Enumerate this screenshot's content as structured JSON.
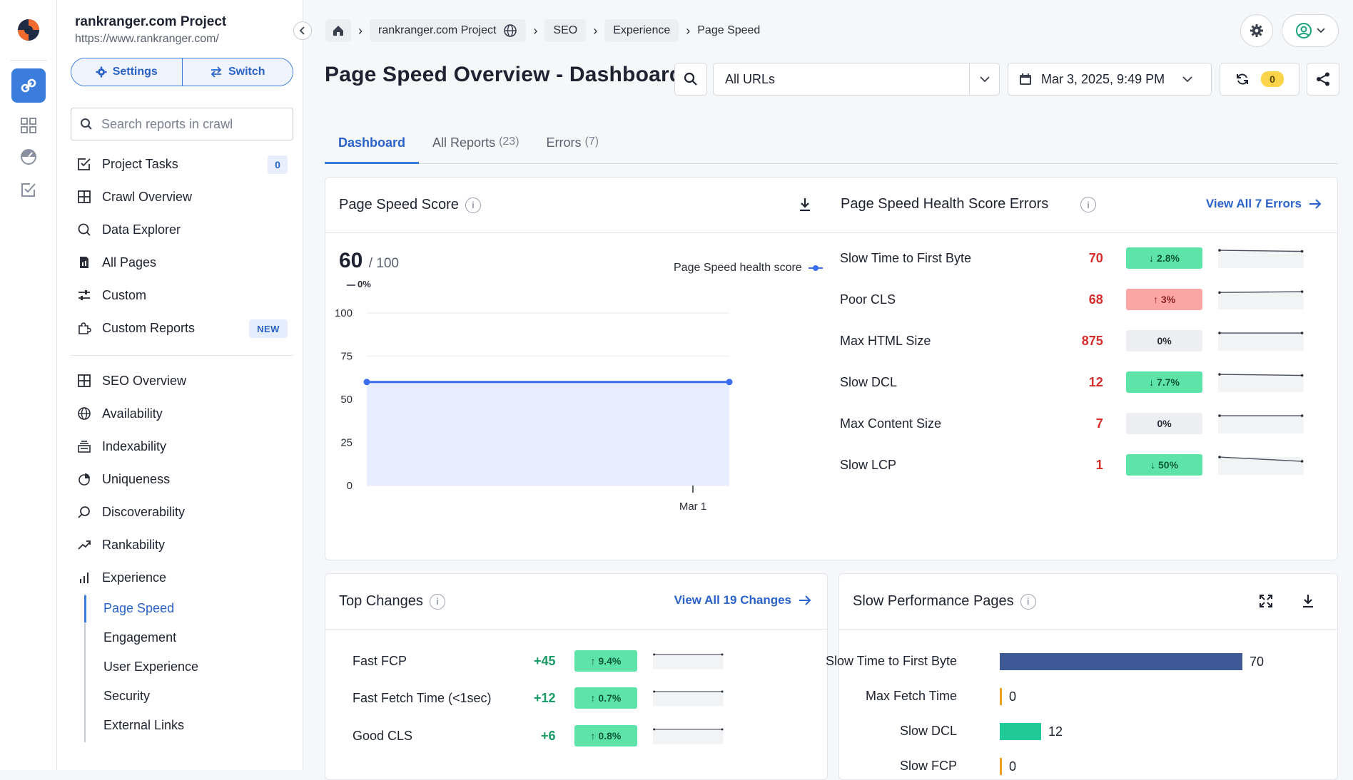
{
  "sidebar": {
    "project_title": "rankranger.com Project",
    "project_url": "https://www.rankranger.com/",
    "settings_label": "Settings",
    "switch_label": "Switch",
    "search_placeholder": "Search reports in crawl",
    "nav_top": [
      {
        "label": "Project Tasks",
        "icon": "tasks-icon",
        "badge": "0"
      },
      {
        "label": "Crawl Overview",
        "icon": "grid-icon"
      },
      {
        "label": "Data Explorer",
        "icon": "search-icon"
      },
      {
        "label": "All Pages",
        "icon": "pages-icon"
      },
      {
        "label": "Custom",
        "icon": "sliders-icon"
      },
      {
        "label": "Custom Reports",
        "icon": "puzzle-icon",
        "tag": "NEW"
      }
    ],
    "nav_bottom": [
      {
        "label": "SEO Overview",
        "icon": "grid-icon"
      },
      {
        "label": "Availability",
        "icon": "globe-icon"
      },
      {
        "label": "Indexability",
        "icon": "stack-icon"
      },
      {
        "label": "Uniqueness",
        "icon": "pie-icon"
      },
      {
        "label": "Discoverability",
        "icon": "magnifier-icon"
      },
      {
        "label": "Rankability",
        "icon": "trend-icon"
      },
      {
        "label": "Experience",
        "icon": "bars-icon"
      }
    ],
    "experience_sub": [
      "Page Speed",
      "Engagement",
      "User Experience",
      "Security",
      "External Links"
    ]
  },
  "breadcrumb": {
    "project": "rankranger.com Project",
    "seo": "SEO",
    "experience": "Experience",
    "current": "Page Speed"
  },
  "header": {
    "title": "Page Speed Overview - Dashboard",
    "url_filter": "All URLs",
    "date": "Mar 3, 2025, 9:49 PM",
    "refresh_count": "0"
  },
  "tabs": [
    {
      "label": "Dashboard",
      "count": ""
    },
    {
      "label": "All Reports",
      "count": "(23)"
    },
    {
      "label": "Errors",
      "count": "(7)"
    }
  ],
  "score_card": {
    "title": "Page Speed Score",
    "score": "60",
    "out_of": "/ 100",
    "change": "0%",
    "legend": "Page Speed health score",
    "series_color": "#3b6ef0",
    "chart_data": {
      "type": "area",
      "title": "Page Speed Score",
      "x": [
        "",
        "Mar 1"
      ],
      "series": [
        {
          "name": "Page Speed health score",
          "values": [
            60,
            60
          ]
        }
      ],
      "ylim": [
        0,
        100
      ],
      "yticks": [
        100,
        75,
        50,
        25,
        0
      ],
      "xtick_labels": [
        "Mar 1"
      ]
    }
  },
  "errors_card": {
    "title": "Page Speed Health Score Errors",
    "view_all": "View All 7 Errors",
    "rows": [
      {
        "label": "Slow Time to First Byte",
        "value": "70",
        "pct": "↓ 2.8%",
        "trend": "down"
      },
      {
        "label": "Poor CLS",
        "value": "68",
        "pct": "↑ 3%",
        "trend": "up"
      },
      {
        "label": "Max HTML Size",
        "value": "875",
        "pct": "0%",
        "trend": "zero"
      },
      {
        "label": "Slow DCL",
        "value": "12",
        "pct": "↓ 7.7%",
        "trend": "down"
      },
      {
        "label": "Max Content Size",
        "value": "7",
        "pct": "0%",
        "trend": "zero"
      },
      {
        "label": "Slow LCP",
        "value": "1",
        "pct": "↓ 50%",
        "trend": "down"
      }
    ]
  },
  "changes_card": {
    "title": "Top Changes",
    "view_all": "View All 19 Changes",
    "rows": [
      {
        "label": "Fast FCP",
        "value": "+45",
        "pct": "↑ 9.4%"
      },
      {
        "label": "Fast Fetch Time (<1sec)",
        "value": "+12",
        "pct": "↑ 0.7%"
      },
      {
        "label": "Good CLS",
        "value": "+6",
        "pct": "↑ 0.8%"
      }
    ]
  },
  "slow_card": {
    "title": "Slow Performance Pages",
    "chart_data": {
      "type": "bar",
      "categories": [
        "Slow Time to First Byte",
        "Max Fetch Time",
        "Slow DCL",
        "Slow FCP"
      ],
      "values": [
        70,
        0,
        12,
        0
      ],
      "colors": [
        "#3f5896",
        "#f0a020",
        "#20c997",
        "#f0a020"
      ]
    }
  }
}
